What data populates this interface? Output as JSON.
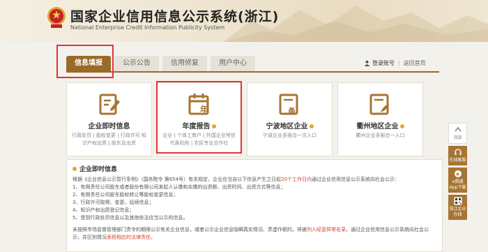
{
  "header": {
    "title_cn": "国家企业信用信息公示系统(浙江)",
    "title_en": "National Enterprise Credit Information Publicity System"
  },
  "tabs": [
    {
      "label": "信息填报",
      "active": true
    },
    {
      "label": "公示公告",
      "active": false
    },
    {
      "label": "信用修复",
      "active": false
    },
    {
      "label": "用户中心",
      "active": false
    }
  ],
  "account": {
    "login_label": "登录账号",
    "back_label": "返回首页"
  },
  "cards": [
    {
      "title": "企业即时信息",
      "subtitle": "行政处罚 | 股权变更 | 行政许可 知识产权出质 | 股东及出资",
      "icon": "edit-document-icon"
    },
    {
      "title": "年度报告",
      "subtitle": "企业 | 个体工商户 | 外国企业常驻代表机构 | 农民专业合作社",
      "icon": "calendar-year-icon"
    },
    {
      "title": "宁波地区企业",
      "subtitle": "宁波企业多报合一次入口",
      "icon": "ningbo-document-icon"
    },
    {
      "title": "衢州地区企业",
      "subtitle": "衢州企业多报合一入口",
      "icon": "quzhou-document-icon"
    }
  ],
  "info": {
    "title": "企业即时信息",
    "intro_a": "根据《企业信息公示暂行条例》（国务院令 第654号）有关规定，企业应当自以下信息产生之日起",
    "intro_hl": "20个工作日内",
    "intro_b": "通过企业信用信息公示系统向社会公示：",
    "items": [
      "1、有限责任公司股东或者股份有限公司发起人认缴和实缴的出资额、出资时间、出资方式等信息；",
      "2、有限责任公司股东股权转让等股权变更信息；",
      "3、行政许可取得、变更、延续信息；",
      "4、知识产权出质登记信息；",
      "5、受到行政处罚信息以及其他依法应当公示的信息。"
    ],
    "foot_a": "未按照市场监督管理部门责令的期限公示有关企业信息，或者公示企业信息隐瞒真实情况、弄虚作假的，将被",
    "foot_hl1": "列入经营异常名录",
    "foot_b": "，通过企业信用信息公示系统向社会公示，并区别情况",
    "foot_hl2": "承担相应的法律责任。"
  },
  "sidebar": {
    "top_label": "顶部",
    "online_label": "在线客服",
    "app_label": "e照通App下载",
    "zj_label": "浙江企业在线"
  },
  "colors": {
    "accent": "#9a6a27",
    "highlight": "#d6402c",
    "annotation": "#e23434",
    "dot": "#e8a42a"
  }
}
